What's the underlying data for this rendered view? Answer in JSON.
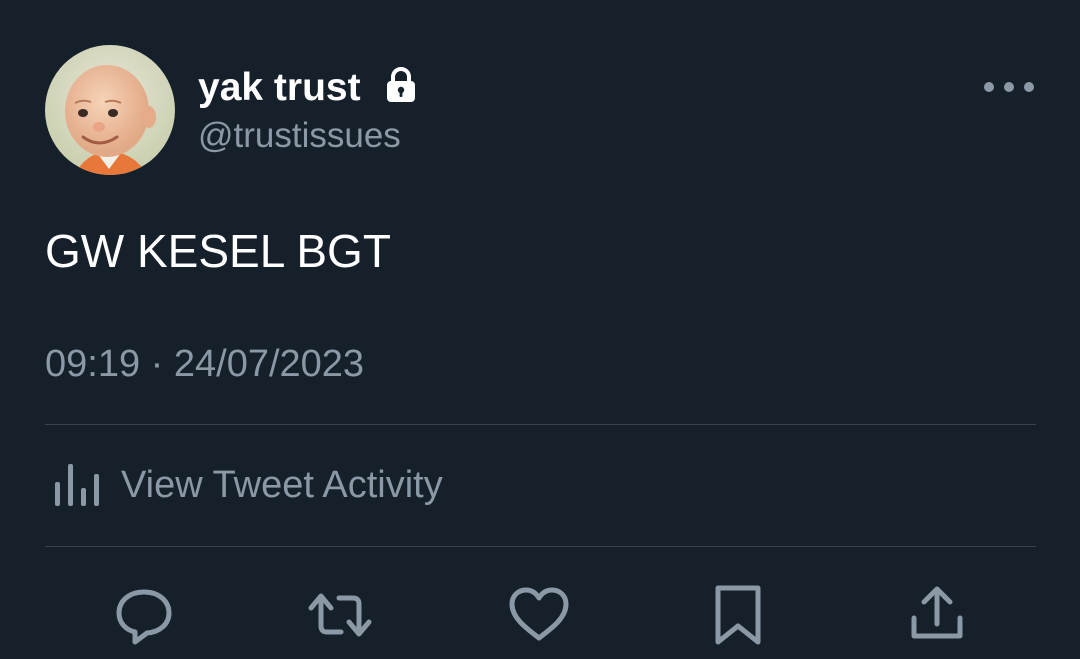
{
  "tweet": {
    "author": {
      "display_name": "yak trust",
      "handle": "@trustissues",
      "protected_icon": "lock-icon",
      "avatar": "profile-avatar"
    },
    "text": "GW KESEL BGT",
    "timestamp": "09:19 · 24/07/2023"
  },
  "activity": {
    "label": "View Tweet Activity",
    "icon": "bar-chart-icon"
  },
  "actions": [
    {
      "name": "reply",
      "icon": "reply-icon"
    },
    {
      "name": "retweet",
      "icon": "retweet-icon"
    },
    {
      "name": "like",
      "icon": "heart-icon"
    },
    {
      "name": "bookmark",
      "icon": "bookmark-icon"
    },
    {
      "name": "share",
      "icon": "share-icon"
    }
  ],
  "colors": {
    "background": "#15202b",
    "primary_text": "#ffffff",
    "secondary_text": "#8b98a5",
    "divider": "#38444d"
  }
}
